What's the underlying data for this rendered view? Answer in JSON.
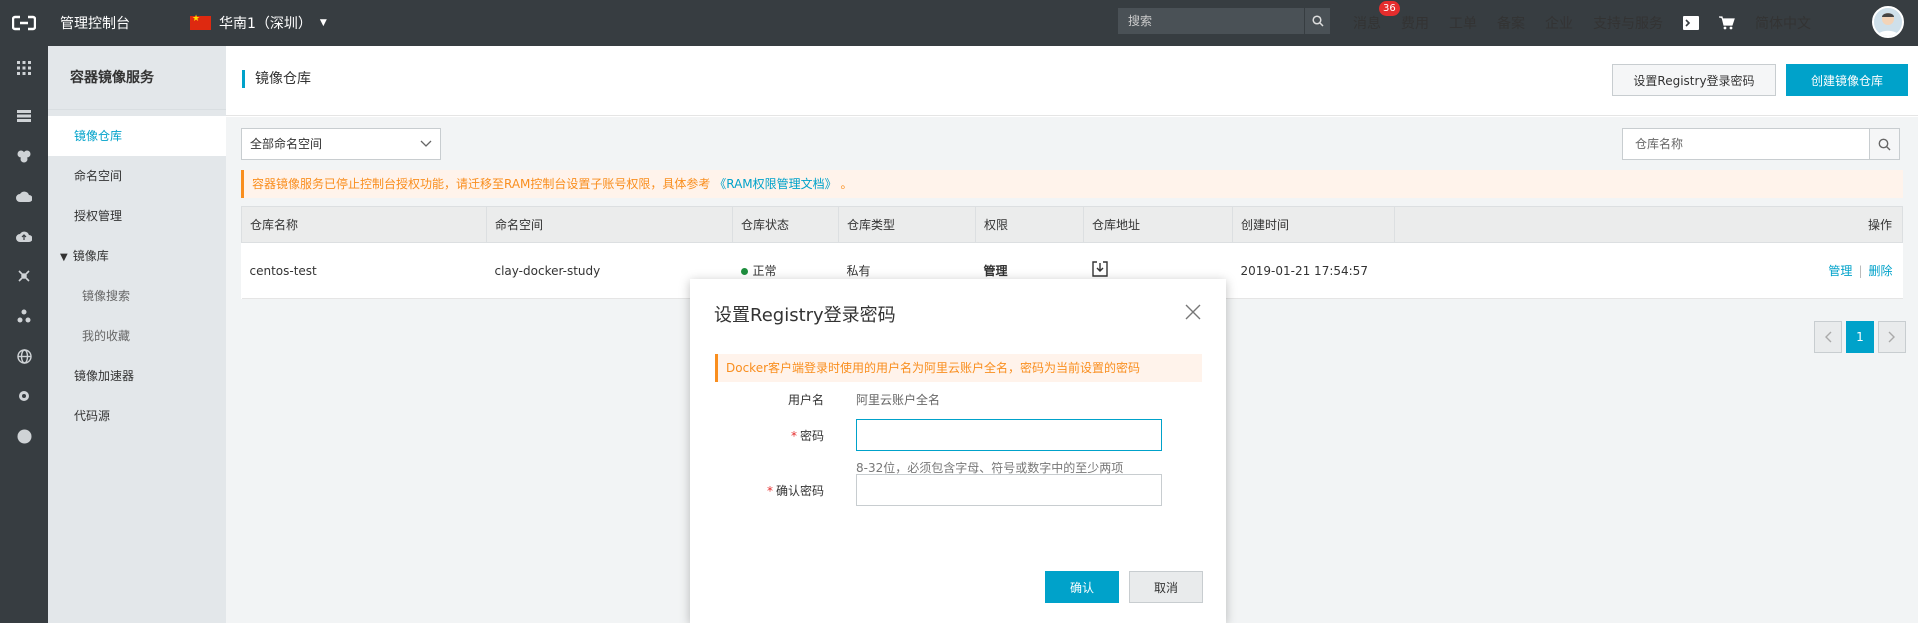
{
  "topbar": {
    "console_title": "管理控制台",
    "region": "华南1（深圳）",
    "search_placeholder": "搜索",
    "nav": {
      "messages": "消息",
      "messages_badge": "36",
      "fees": "费用",
      "tickets": "工单",
      "filing": "备案",
      "enterprise": "企业",
      "support": "支持与服务",
      "language": "简体中文"
    }
  },
  "rail": {
    "icons": [
      "grid-icon",
      "server-icon",
      "database-icon",
      "cloud-icon",
      "cloud-upload-icon",
      "network-icon",
      "nodes-icon",
      "globe-icon",
      "gear-icon",
      "circle-icon"
    ]
  },
  "sidebar": {
    "title": "容器镜像服务",
    "items": [
      {
        "label": "镜像仓库"
      },
      {
        "label": "命名空间"
      },
      {
        "label": "授权管理"
      },
      {
        "label": "镜像库"
      },
      {
        "label": "镜像搜索"
      },
      {
        "label": "我的收藏"
      },
      {
        "label": "镜像加速器"
      },
      {
        "label": "代码源"
      }
    ]
  },
  "main": {
    "title": "镜像仓库",
    "btn_set_password": "设置Registry登录密码",
    "btn_create_repo": "创建镜像仓库",
    "namespace_select": "全部命名空间",
    "repo_search_placeholder": "仓库名称",
    "notice_text": "容器镜像服务已停止控制台授权功能，请迁移至RAM控制台设置子账号权限，具体参考",
    "notice_link": "《RAM权限管理文档》",
    "notice_end": "。",
    "table": {
      "headers": [
        "仓库名称",
        "命名空间",
        "仓库状态",
        "仓库类型",
        "权限",
        "仓库地址",
        "创建时间",
        "操作"
      ],
      "rows": [
        {
          "name": "centos-test",
          "namespace": "clay-docker-study",
          "status": "正常",
          "type": "私有",
          "permission": "管理",
          "created": "2019-01-21 17:54:57",
          "op_manage": "管理",
          "op_sep": "|",
          "op_delete": "删除"
        }
      ]
    },
    "pager": {
      "current": "1"
    }
  },
  "dialog": {
    "title": "设置Registry登录密码",
    "notice": "Docker客户端登录时使用的用户名为阿里云账户全名，密码为当前设置的密码",
    "username_label": "用户名",
    "username_value": "阿里云账户全名",
    "required_mark": "*",
    "password_label": "密码",
    "password_value": "",
    "password_hint": "8-32位，必须包含字母、符号或数字中的至少两项",
    "confirm_label": "确认密码",
    "confirm_value": "",
    "ok": "确认",
    "cancel": "取消"
  },
  "colors": {
    "accent": "#00a2ca",
    "topbar": "#373d41",
    "warning": "#f98e1e",
    "status_ok": "#1e8e3e"
  }
}
